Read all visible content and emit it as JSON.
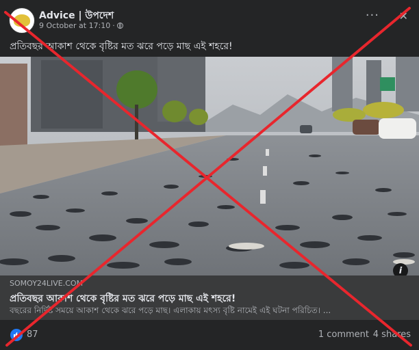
{
  "post": {
    "page_name": "Advice | উপদেশ",
    "timestamp": "9 October at 17:10",
    "separator": "·",
    "text": "প্রতিবছর আকাশ থেকে বৃষ্টির মত ঝরে পড়ে মাছ এই শহরে!",
    "more_label": "···",
    "close_label": "✕"
  },
  "link_preview": {
    "domain": "SOMOY24LIVE.COM",
    "title": "প্রতিবছর আকাশ থেকে বৃষ্টির মত ঝরে পড়ে মাছ এই শহরে!",
    "description": "বছরের নির্দিষ্ট সময়ে আকাশ থেকে ঝরে পড়ে মাছ। এলাকায় মৎস্য বৃষ্টি নামেই এই ঘটনা পরিচিত। ..."
  },
  "image": {
    "info_label": "i",
    "overlay": "red-cross-mark"
  },
  "footer": {
    "reaction_count": "87",
    "comments": "1 comment",
    "shares": "4 shares"
  },
  "colors": {
    "background": "#242526",
    "card": "#3a3b3c",
    "like_blue": "#2078f4",
    "cross_red": "#e8262d"
  }
}
